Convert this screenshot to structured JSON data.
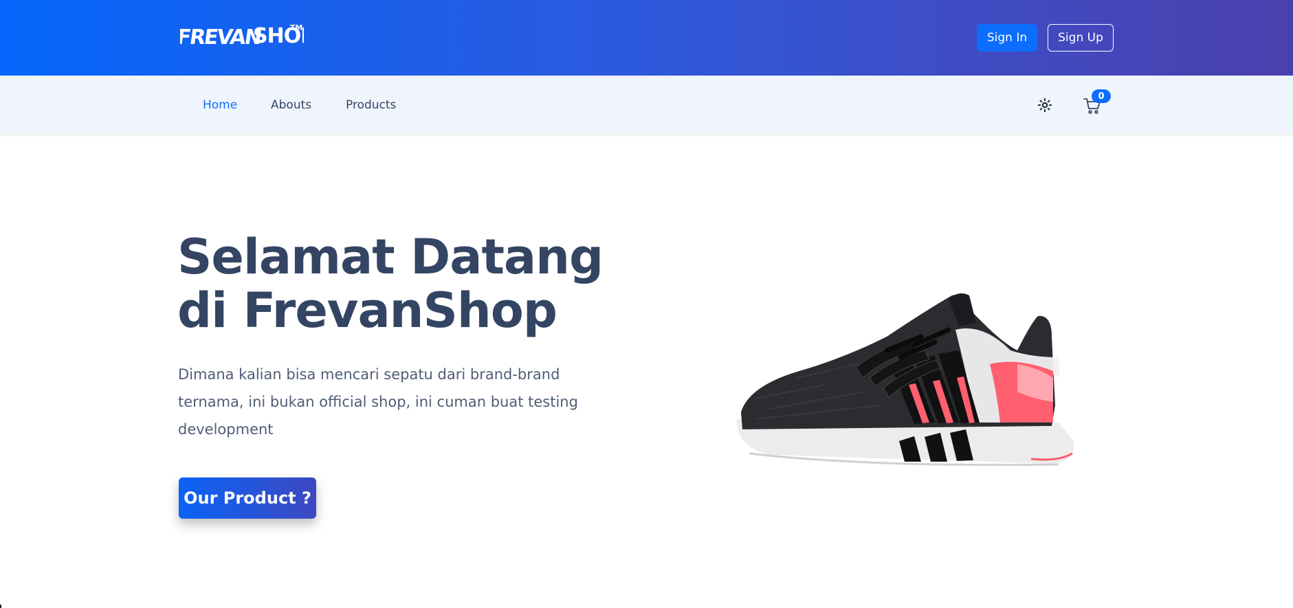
{
  "header": {
    "logo_text": "FREVANSHOP™",
    "signin_label": "Sign In",
    "signup_label": "Sign Up"
  },
  "nav": {
    "items": [
      {
        "label": "Home",
        "active": true
      },
      {
        "label": "Abouts",
        "active": false
      },
      {
        "label": "Products",
        "active": false
      }
    ],
    "theme_icon": "sun-icon",
    "cart_icon": "cart-icon",
    "cart_count": "0"
  },
  "hero": {
    "title": "Selamat Datang di FrevanShop",
    "description": "Dimana kalian bisa mencari sepatu dari brand-brand ternama, ini bukan official shop, ini cuman buat testing development",
    "cta_label": "Our Product ?"
  },
  "colors": {
    "primary": "#0d6efd",
    "header_gradient_start": "#0466fb",
    "header_gradient_end": "#4a40ad",
    "nav_bg": "#f0f5fd",
    "text_dark": "#344563"
  }
}
